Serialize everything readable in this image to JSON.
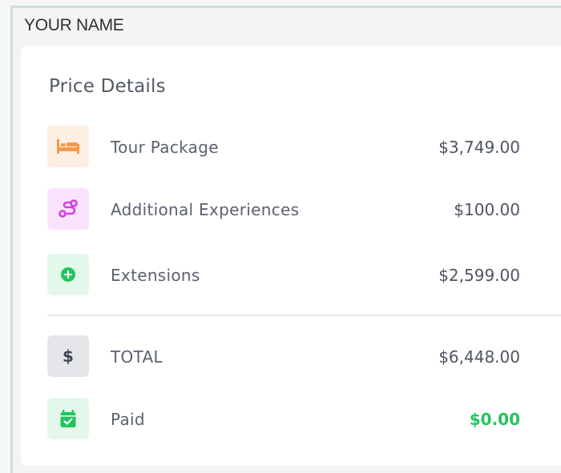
{
  "header": {
    "name": "YOUR NAME"
  },
  "price_details": {
    "title": "Price Details",
    "rows": [
      {
        "label": "Tour Package",
        "value": "$3,749.00",
        "icon": "bed-icon",
        "icon_color": "#f39a4c",
        "icon_bg": "#fdeee2"
      },
      {
        "label": "Additional Experiences",
        "value": "$100.00",
        "icon": "route-icon",
        "icon_color": "#d43fe0",
        "icon_bg": "#fbe3fd"
      },
      {
        "label": "Extensions",
        "value": "$2,599.00",
        "icon": "plus-circle-icon",
        "icon_color": "#22c55e",
        "icon_bg": "#e3f8ea"
      }
    ],
    "summary": [
      {
        "label": "TOTAL",
        "value": "$6,448.00",
        "icon": "dollar-icon",
        "icon_color": "#3f4452",
        "icon_bg": "#e4e6ea"
      },
      {
        "label": "Paid",
        "value": "$0.00",
        "icon": "calendar-check-icon",
        "icon_color": "#22c55e",
        "icon_bg": "#e3f8ea",
        "value_color": "#22c55e"
      }
    ]
  }
}
